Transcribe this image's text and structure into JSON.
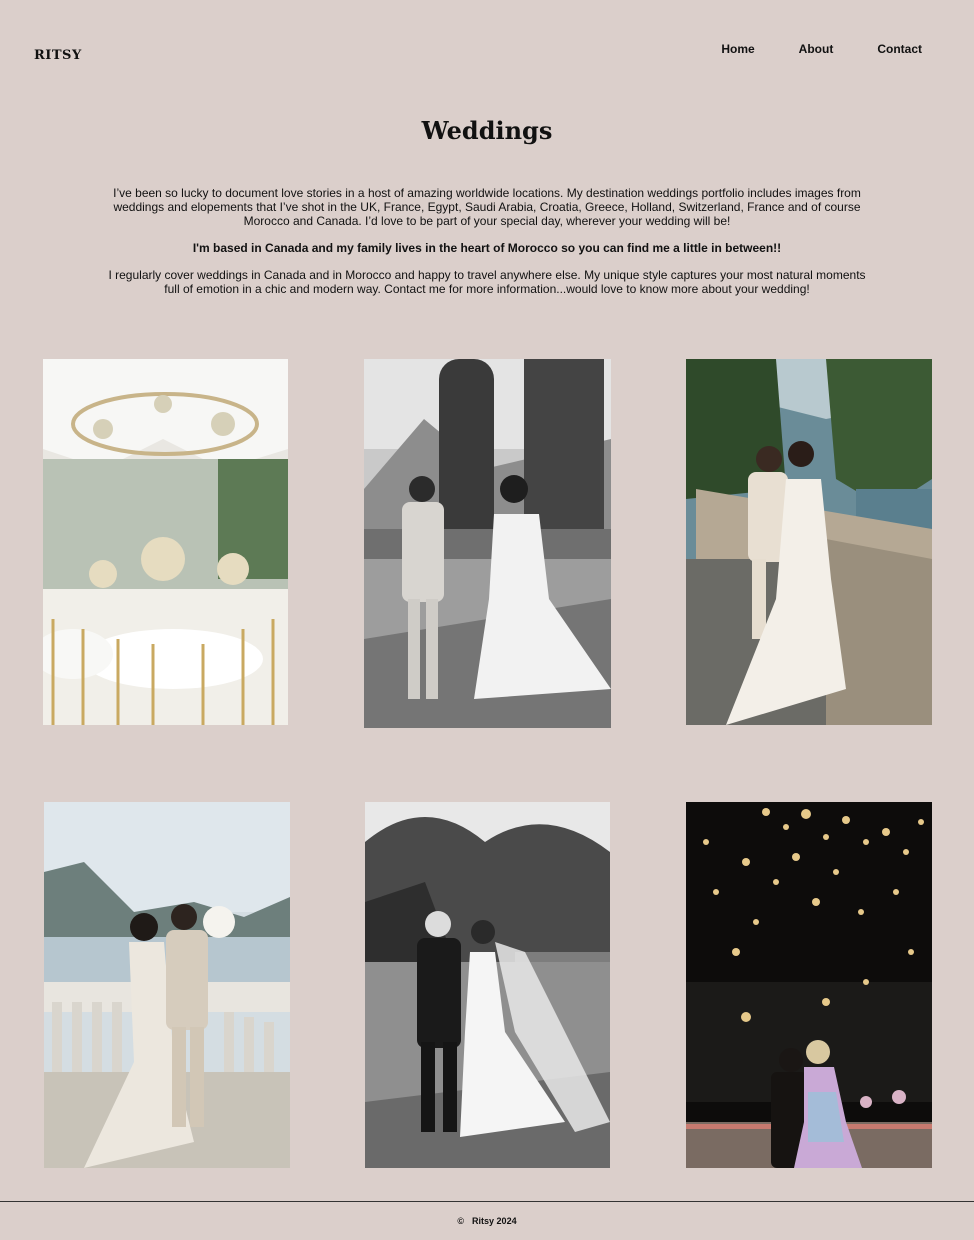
{
  "brand": {
    "logo": "RITSY"
  },
  "nav": {
    "items": [
      {
        "label": "Home"
      },
      {
        "label": "About"
      },
      {
        "label": "Contact"
      }
    ]
  },
  "page": {
    "title": "Weddings",
    "paragraphs": [
      "I’ve been so lucky to document love stories in a host of amazing worldwide locations. My destination weddings portfolio includes images from weddings and elopements that I’ve shot in the UK, France, Egypt, Saudi Arabia, Croatia, Greece, Holland, Switzerland, France and of course Morocco and Canada. I’d love to be part of your special day, wherever your wedding will be!",
      "I'm based in Canada and my family lives in the heart of Morocco so you can find me a little in between!!",
      "I regularly cover weddings in Canada and in Morocco and happy to travel anywhere else. My unique style captures your most natural moments full of emotion in a chic and modern way. Contact me for more information...would love to know more about your wedding!"
    ]
  },
  "gallery": {
    "photos": [
      {
        "name": "reception-table-photo"
      },
      {
        "name": "couple-holding-hands-bw-photo"
      },
      {
        "name": "couple-on-balcony-photo"
      },
      {
        "name": "couple-lakeside-photo"
      },
      {
        "name": "couple-walking-bw-photo"
      },
      {
        "name": "fireworks-photo"
      }
    ]
  },
  "footer": {
    "copyright_symbol": "©",
    "text": "Ritsy 2024"
  }
}
